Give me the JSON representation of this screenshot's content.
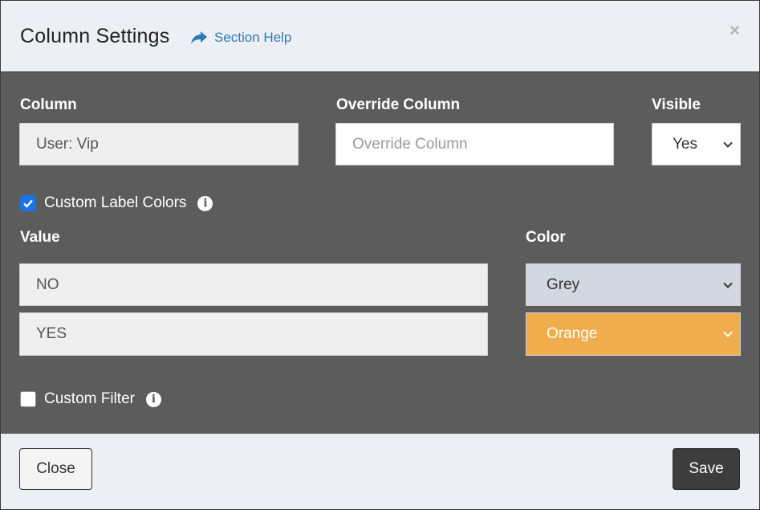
{
  "modal": {
    "title": "Column Settings",
    "help_label": "Section Help",
    "close_symbol": "×"
  },
  "form": {
    "column_label": "Column",
    "column_value": "User: Vip",
    "override_label": "Override Column",
    "override_value": "",
    "override_placeholder": "Override Column",
    "visible_label": "Visible",
    "visible_value": "Yes",
    "custom_label_colors": {
      "label": "Custom Label Colors",
      "checked": true
    },
    "value_header": "Value",
    "color_header": "Color",
    "rows": [
      {
        "value": "NO",
        "color": "Grey",
        "color_hex": "#d3d8e0",
        "text_hex": "#333333"
      },
      {
        "value": "YES",
        "color": "Orange",
        "color_hex": "#f0ad4e",
        "text_hex": "#ffffff"
      }
    ],
    "custom_filter": {
      "label": "Custom Filter",
      "checked": false
    }
  },
  "footer": {
    "close_label": "Close",
    "save_label": "Save"
  },
  "icons": {
    "help": "share-arrow-icon",
    "info": "info-circle-icon",
    "chevron": "chevron-down-icon",
    "close": "close-icon"
  }
}
